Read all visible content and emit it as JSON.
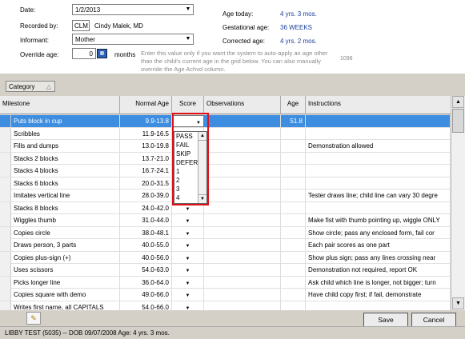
{
  "form": {
    "date_label": "Date:",
    "date_value": "1/2/2013",
    "recorded_label": "Recorded by:",
    "recorder_code": "CLM",
    "recorder_name": "Cindy Malek, MD",
    "informant_label": "Informant:",
    "informant_value": "Mother",
    "override_label": "Override age:",
    "override_value": "0",
    "months_label": "months",
    "age_today_label": "Age today:",
    "age_today_value": "4 yrs. 3 mos.",
    "gest_label": "Gestational age:",
    "gest_value": "36 WEEKS",
    "corrected_label": "Corrected age:",
    "corrected_value": "4 yrs. 2 mos.",
    "hint": "Enter this value only if you want the system to auto-apply an age other than the child's current age in the grid below. You can also manually override the Age Achvd column.",
    "code": "1098"
  },
  "category_label": "Category",
  "grid": {
    "headers": [
      "Milestone",
      "Normal Age",
      "Score",
      "Observations",
      "Age",
      "Instructions"
    ],
    "rows": [
      {
        "milestone": "Puts block in cup",
        "normal": "9.9-13.8",
        "age": "51.8",
        "instr": ""
      },
      {
        "milestone": "Scribbles",
        "normal": "11.9-16.5",
        "age": "",
        "instr": ""
      },
      {
        "milestone": "Fills and dumps",
        "normal": "13.0-19.8",
        "age": "",
        "instr": "Demonstration allowed"
      },
      {
        "milestone": "Stacks 2 blocks",
        "normal": "13.7-21.0",
        "age": "",
        "instr": ""
      },
      {
        "milestone": "Stacks 4 blocks",
        "normal": "16.7-24.1",
        "age": "",
        "instr": ""
      },
      {
        "milestone": "Stacks 6 blocks",
        "normal": "20.0-31.5",
        "age": "",
        "instr": ""
      },
      {
        "milestone": "Imitates vertical line",
        "normal": "28.0-39.0",
        "age": "",
        "instr": "Tester draws line; child line can vary 30 degre"
      },
      {
        "milestone": "Stacks 8 blocks",
        "normal": "24.0-42.0",
        "age": "",
        "instr": ""
      },
      {
        "milestone": "Wiggles thumb",
        "normal": "31.0-44.0",
        "age": "",
        "instr": "Make fist with thumb pointing up, wiggle ONLY"
      },
      {
        "milestone": "Copies circle",
        "normal": "38.0-48.1",
        "age": "",
        "instr": "Show circle; pass any enclosed form, fail cor"
      },
      {
        "milestone": "Draws person, 3 parts",
        "normal": "40.0-55.0",
        "age": "",
        "instr": "Each pair scores as one part"
      },
      {
        "milestone": "Copies plus-sign (+)",
        "normal": "40.0-56.0",
        "age": "",
        "instr": "Show plus sign; pass any lines crossing near"
      },
      {
        "milestone": "Uses scissors",
        "normal": "54.0-63.0",
        "age": "",
        "instr": "Demonstration not required, report OK"
      },
      {
        "milestone": "Picks longer line",
        "normal": "36.0-64.0",
        "age": "",
        "instr": "Ask child which line is longer, not bigger; turn"
      },
      {
        "milestone": "Copies square with demo",
        "normal": "49.0-66.0",
        "age": "",
        "instr": "Have child copy first; if fail, demonstrate"
      },
      {
        "milestone": "Writes first name, all CAPITALS",
        "normal": "54.0-66.0",
        "age": "",
        "instr": ""
      }
    ]
  },
  "score_dropdown": {
    "options": [
      "PASS",
      "FAIL",
      "SKIP",
      "DEFER",
      "1",
      "2",
      "3",
      "4"
    ]
  },
  "buttons": {
    "save": "Save",
    "cancel": "Cancel"
  },
  "status": "LIBBY TEST (5035) -- DOB 09/07/2008  Age: 4 yrs. 3 mos."
}
